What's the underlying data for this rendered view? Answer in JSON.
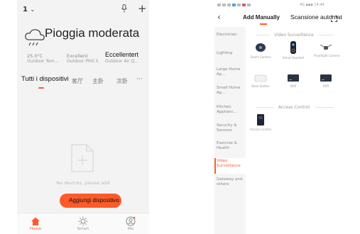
{
  "left_phone": {
    "header": {
      "home_name": "1",
      "chevron": "chevron-down-icon",
      "mic_icon": "microphone-icon",
      "plus_icon": "+"
    },
    "weather": {
      "icon": "cloud-rain-icon",
      "title": "Pioggia moderata",
      "stats": [
        {
          "value": "25.0°C",
          "label": "Outdoor Tem..."
        },
        {
          "value": "Excellent",
          "label": "Outdoor PM2.5"
        },
        {
          "value": "Eccellentert",
          "label": "Outdoor Air Q..."
        }
      ]
    },
    "tabs": {
      "all": "Tutti i dispositivi",
      "room1": "客厅",
      "room2": "主卧",
      "room3": "次卧",
      "more": "···"
    },
    "empty_state": {
      "icon": "add-document-icon",
      "text": "No devices, please add"
    },
    "add_button_label": "Aggiungi dispositivo",
    "bottom_nav": [
      {
        "label": "Home",
        "icon": "home-icon",
        "active": true
      },
      {
        "label": "Smart",
        "icon": "sun-icon",
        "active": false
      },
      {
        "label": "Me",
        "icon": "profile-icon",
        "active": false
      }
    ],
    "accent_color": "#ff5a2a"
  },
  "right_phone": {
    "status_right": "4G ▪▪▪ 14:44",
    "tabs": {
      "manual": "Add Manually",
      "auto": "Scansione automatica"
    },
    "categories": [
      "Electrician",
      "Lighting",
      "Large Home Ap...",
      "Small Home Ap...",
      "Kitchen Applianc...",
      "Security & Sensors",
      "Exercise & Health",
      "Video Surveillance",
      "Gateway and others"
    ],
    "active_category_index": 7,
    "sections": [
      {
        "title": "Video Surveillance",
        "devices": [
          {
            "label": "Smart Camera",
            "icon": "smart-camera-icon"
          },
          {
            "label": "Smart Doorbell",
            "icon": "doorbell-icon"
          },
          {
            "label": "Floodlight Camera",
            "icon": "floodlight-camera-icon"
          },
          {
            "label": "Base Station",
            "icon": "base-station-icon"
          },
          {
            "label": "NVR",
            "icon": "nvr-icon"
          },
          {
            "label": "DVR",
            "icon": "dvr-icon"
          }
        ]
      },
      {
        "title": "Access Control",
        "devices": [
          {
            "label": "Access Control",
            "icon": "access-control-icon"
          }
        ]
      }
    ]
  }
}
